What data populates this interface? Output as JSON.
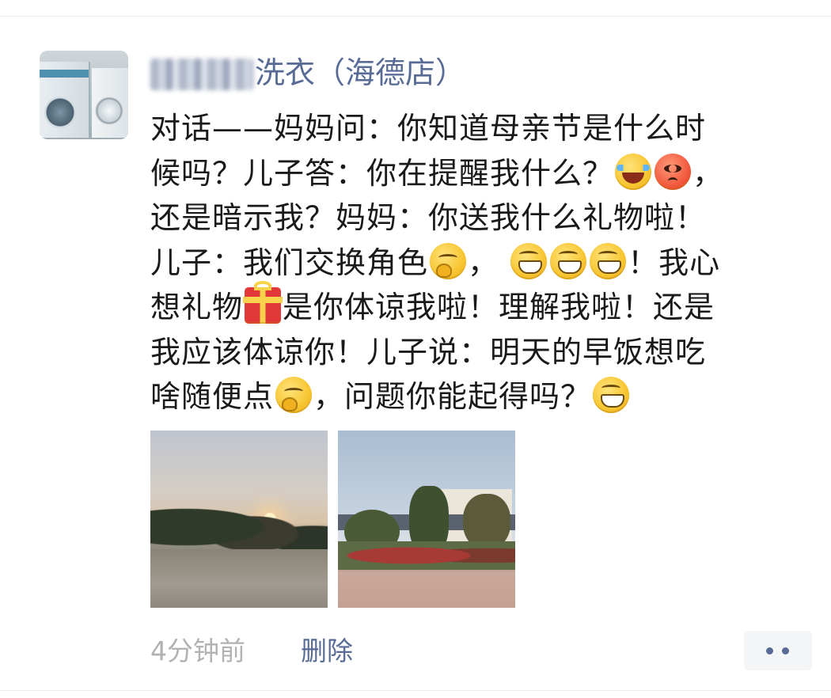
{
  "post": {
    "author_name": "洗衣（海德店）",
    "lines": [
      "对话——妈妈问：你知道母亲节是什么时",
      "候吗？儿子答：你在提醒我什么？",
      "还是暗示我？妈妈：你送我什么礼物啦！",
      "儿子：我们交换角色",
      "想礼物",
      "我应该体谅你！儿子说：明天的早饭想吃",
      "啥随便点"
    ],
    "line2_tail": "，",
    "line4_mid": "，",
    "line4_tail": "！我心",
    "line5_tail": "是你体谅我啦！理解我啦！还是",
    "line7_tail": "，问题你能起得吗？",
    "emojis": [
      "laugh-cry-emoji",
      "angry-emoji",
      "smirk-emoji",
      "grin-emoji",
      "gift-emoji"
    ],
    "photo_count": 2
  },
  "footer": {
    "timestamp": "4分钟前",
    "delete_label": "删除"
  },
  "colors": {
    "name": "#576b95",
    "text": "#1a1a1a",
    "muted": "#b2b2b2"
  }
}
